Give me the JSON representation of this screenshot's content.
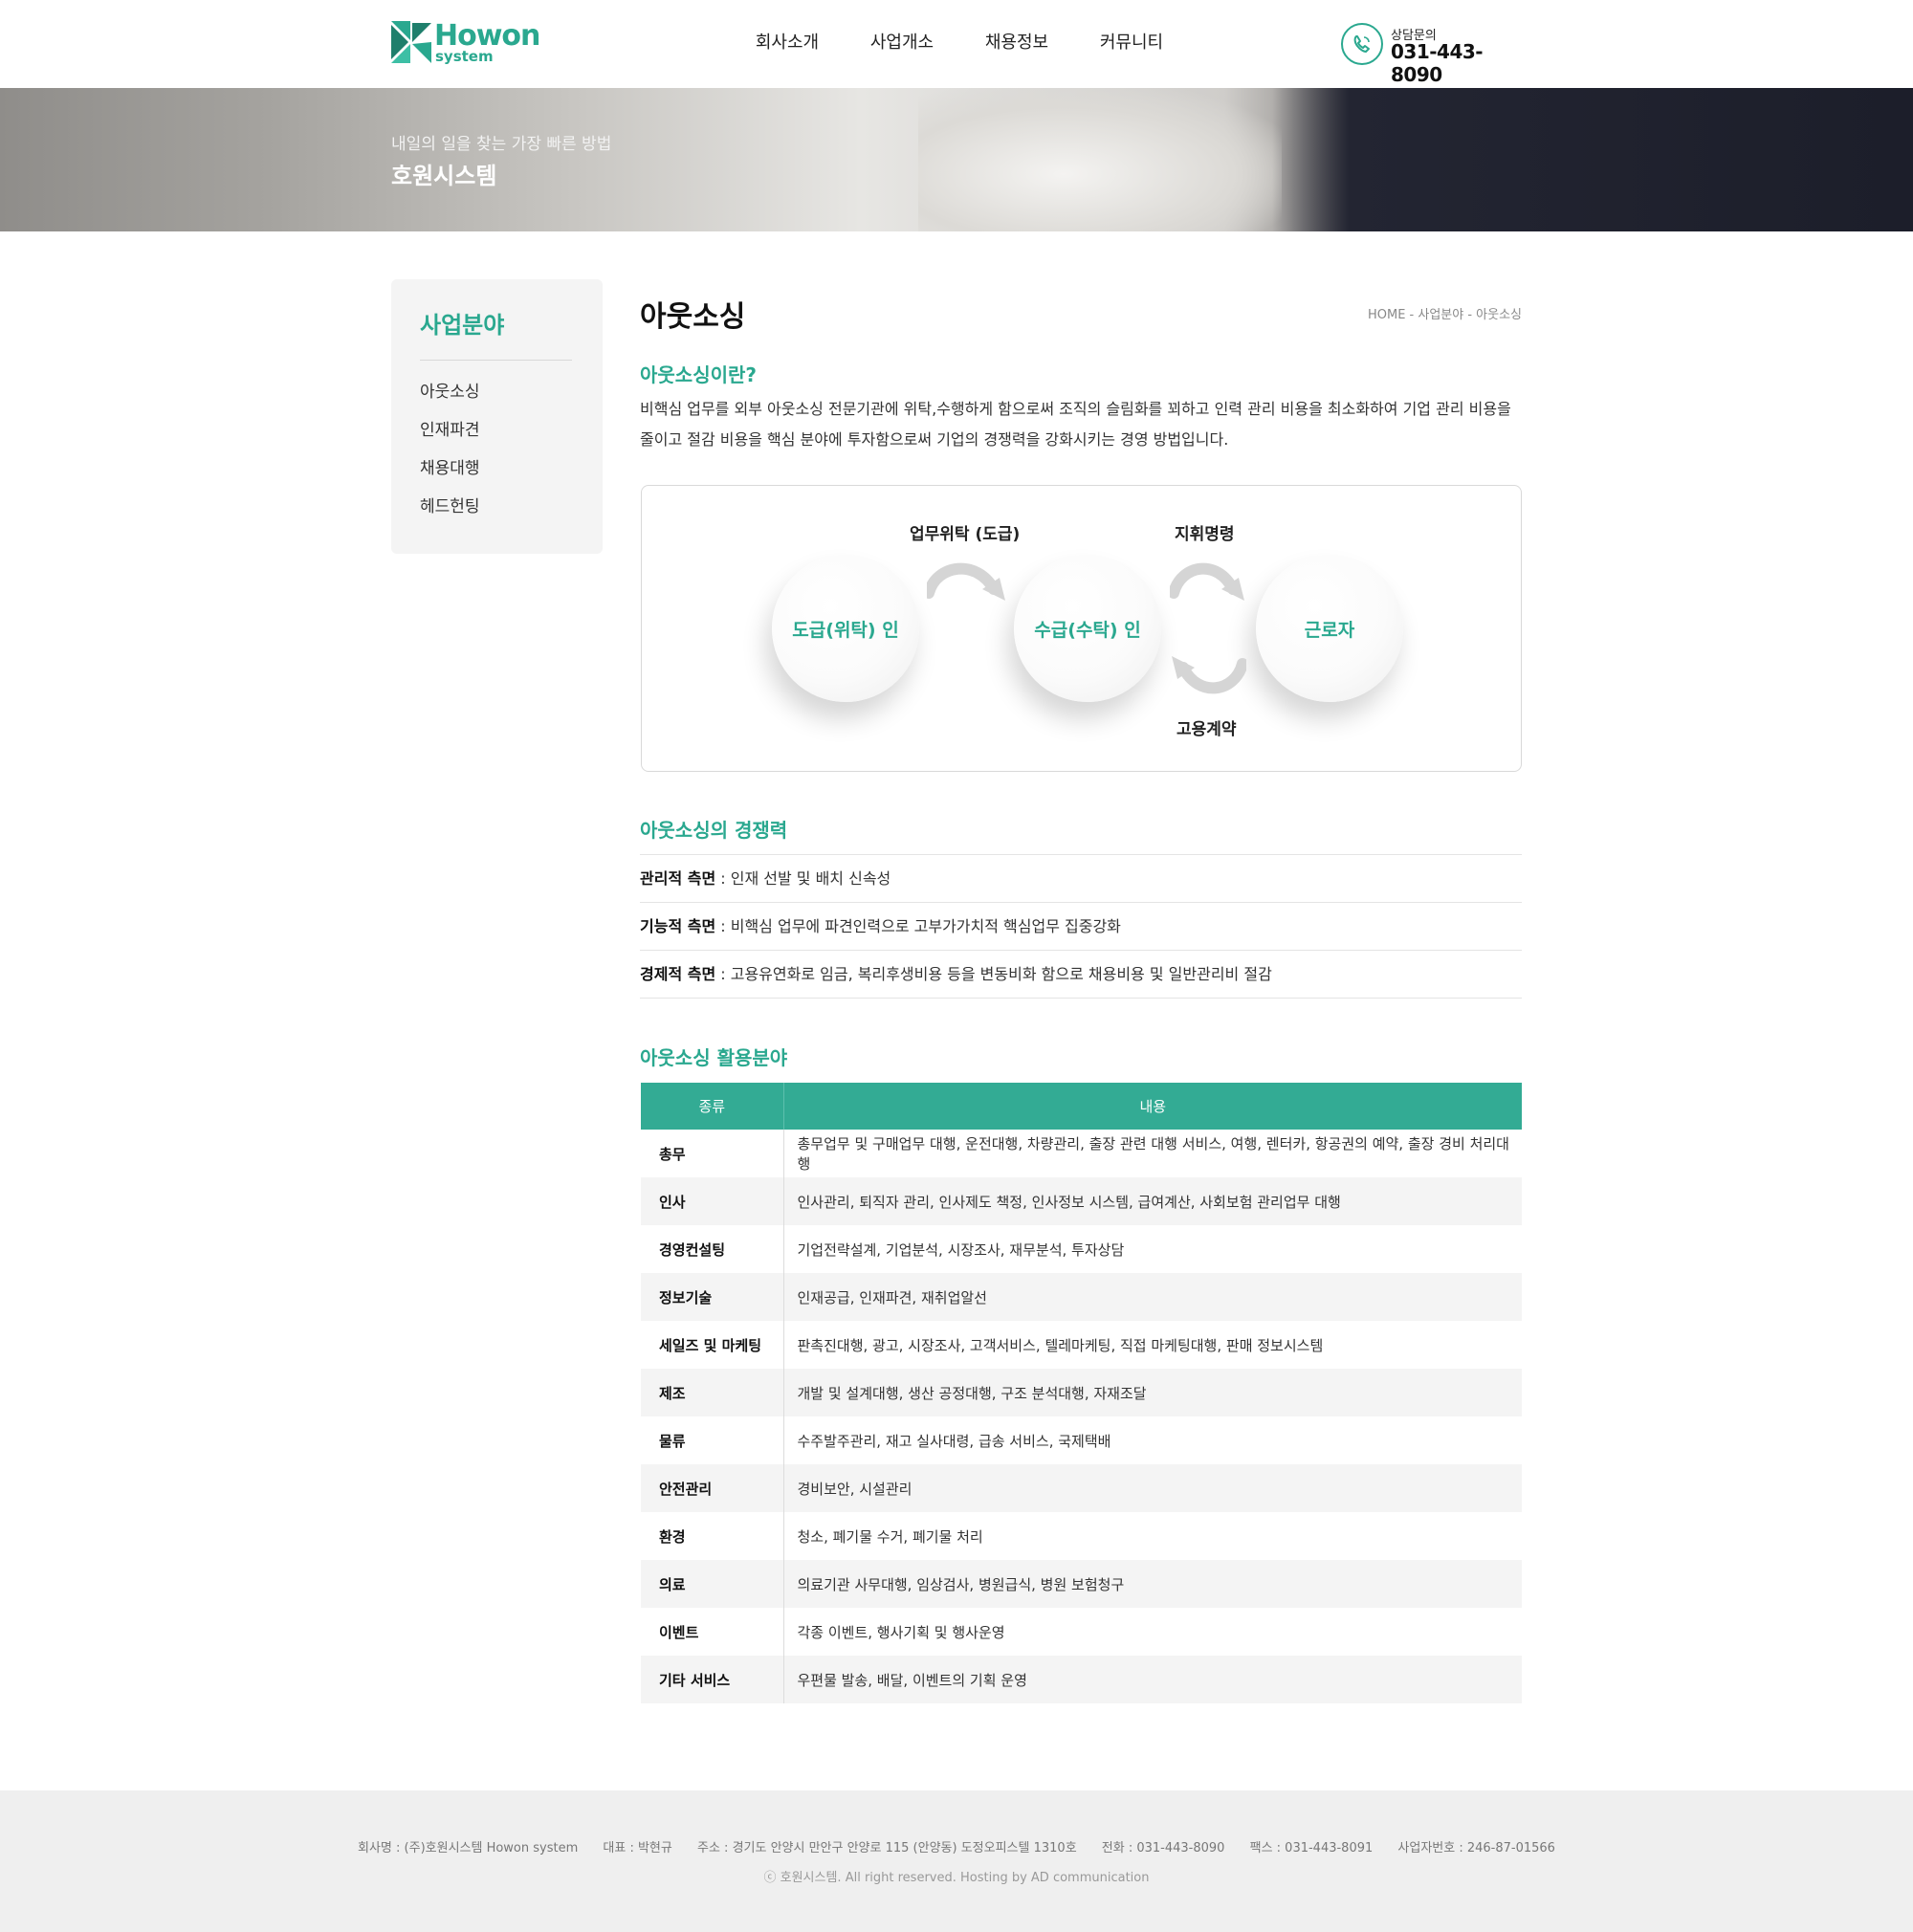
{
  "header": {
    "logo_word": "Howon",
    "logo_sub": "system",
    "nav": [
      "회사소개",
      "사업개소",
      "채용정보",
      "커뮤니티"
    ],
    "contact_label": "상담문의",
    "contact_phone": "031-443-8090"
  },
  "banner": {
    "subtitle": "내일의 일을 찾는 가장 빠른 방법",
    "title": "호원시스템"
  },
  "sidebar": {
    "title": "사업분야",
    "items": [
      "아웃소싱",
      "인재파견",
      "채용대행",
      "헤드헌팅"
    ]
  },
  "main": {
    "title": "아웃소싱",
    "breadcrumb": "HOME - 사업분야 - 아웃소싱",
    "section1": {
      "title": "아웃소싱이란?",
      "text": "비핵심 업무를 외부 아웃소싱 전문기관에 위탁,수행하게 함으로써 조직의 슬림화를 꾀하고 인력 관리 비용을 최소화하여 기업 관리 비용을 줄이고 절감 비용을 핵심 분야에 투자함으로써 기업의 경쟁력을 강화시키는 경영 방법입니다."
    },
    "diagram": {
      "nodes": [
        "도급(위탁) 인",
        "수급(수탁) 인",
        "근로자"
      ],
      "label_contract": "업무위탁 (도급)",
      "label_command": "지휘명령",
      "label_employment": "고용계약"
    },
    "section2": {
      "title": "아웃소싱의 경쟁력",
      "items": [
        {
          "label": "관리적 측면",
          "text": " : 인재 선발 및 배치 신속성"
        },
        {
          "label": "기능적 측면",
          "text": " : 비핵심 업무에 파견인력으로 고부가가치적 핵심업무 집중강화"
        },
        {
          "label": "경제적 측면",
          "text": " : 고용유연화로 임금, 복리후생비용 등을 변동비화 함으로 채용비용 및 일반관리비 절감"
        }
      ]
    },
    "section3": {
      "title": "아웃소싱 활용분야",
      "headers": [
        "종류",
        "내용"
      ],
      "rows": [
        {
          "kind": "총무",
          "desc": "총무업무 및 구매업무 대행, 운전대행, 차량관리, 출장 관련 대행 서비스, 여행, 렌터카, 항공권의 예약, 출장 경비 처리대행"
        },
        {
          "kind": "인사",
          "desc": "인사관리, 퇴직자 관리, 인사제도 책정, 인사정보 시스템, 급여계산, 사회보험 관리업무 대행"
        },
        {
          "kind": "경영컨설팅",
          "desc": "기업전략설계, 기업분석, 시장조사, 재무분석, 투자상담"
        },
        {
          "kind": "정보기술",
          "desc": "인재공급, 인재파견, 재취업알선"
        },
        {
          "kind": "세일즈 및 마케팅",
          "desc": "판촉진대행, 광고, 시장조사, 고객서비스, 텔레마케팅, 직접 마케팅대행, 판매 정보시스템"
        },
        {
          "kind": "제조",
          "desc": "개발 및 설계대행, 생산 공정대행, 구조 분석대행, 자재조달"
        },
        {
          "kind": "물류",
          "desc": "수주발주관리, 재고 실사대령, 급송 서비스, 국제택배"
        },
        {
          "kind": "안전관리",
          "desc": "경비보안, 시설관리"
        },
        {
          "kind": "환경",
          "desc": "청소, 폐기물 수거, 폐기물 처리"
        },
        {
          "kind": "의료",
          "desc": "의료기관 사무대행, 임상검사, 병원급식, 병원 보험청구"
        },
        {
          "kind": "이벤트",
          "desc": "각종 이벤트, 행사기획 및 행사운영"
        },
        {
          "kind": "기타 서비스",
          "desc": "우편물 발송, 배달, 이벤트의 기획 운영"
        }
      ]
    }
  },
  "footer": {
    "company": "회사명 : (주)호원시스템 Howon system",
    "ceo": "대표 : 박현규",
    "address": "주소 : 경기도 안양시 만안구 안양로 115 (안양동) 도정오피스텔 1310호",
    "phone": "전화 : 031-443-8090",
    "fax": "팩스 : 031-443-8091",
    "biz_no": "사업자번호 : 246-87-01566",
    "copyright": "ⓒ 호원시스템. All right reserved. Hosting by AD communication"
  },
  "colors": {
    "accent": "#2aa88f",
    "table_header": "#33ab94",
    "footer_bg": "#efefef"
  }
}
